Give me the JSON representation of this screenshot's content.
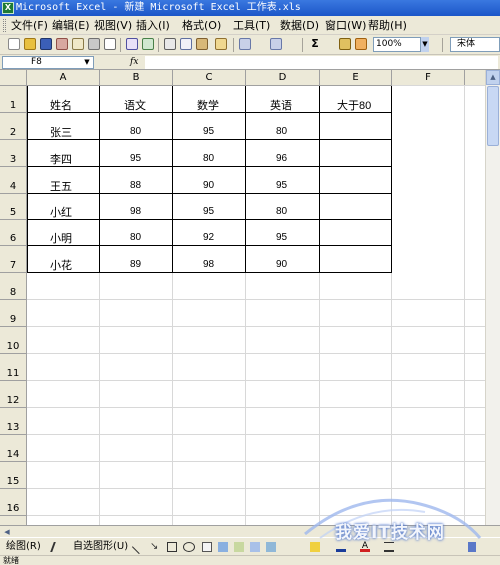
{
  "app": {
    "title": "Microsoft Excel - 新建 Microsoft Excel 工作表.xls",
    "icon_label": "X"
  },
  "menu": {
    "items": [
      "文件(F)",
      "编辑(E)",
      "视图(V)",
      "插入(I)",
      "格式(O)",
      "工具(T)",
      "数据(D)",
      "窗口(W)",
      "帮助(H)"
    ]
  },
  "toolbar": {
    "zoom": "100%",
    "font": "宋体",
    "icons": [
      "new-icon",
      "open-icon",
      "save-icon",
      "permission-icon",
      "email-icon",
      "print-icon",
      "print-preview-icon",
      "spelling-icon",
      "research-icon",
      "cut-icon",
      "copy-icon",
      "paste-icon",
      "format-painter-icon",
      "undo-icon",
      "redo-icon",
      "autosum-icon",
      "chart-wizard-icon",
      "drawing-icon"
    ]
  },
  "formula_bar": {
    "name_box": "F8",
    "fx": "fx",
    "formula": ""
  },
  "sheet": {
    "columns": [
      "A",
      "B",
      "C",
      "D",
      "E",
      "F"
    ],
    "rows": [
      "1",
      "2",
      "3",
      "4",
      "5",
      "6",
      "7",
      "8",
      "9",
      "10",
      "11",
      "12",
      "13",
      "14",
      "15",
      "16"
    ],
    "headers": [
      "姓名",
      "语文",
      "数学",
      "英语",
      "大于80"
    ],
    "data": [
      [
        "张三",
        "80",
        "95",
        "80",
        ""
      ],
      [
        "李四",
        "95",
        "80",
        "96",
        ""
      ],
      [
        "王五",
        "88",
        "90",
        "95",
        ""
      ],
      [
        "小红",
        "98",
        "95",
        "80",
        ""
      ],
      [
        "小明",
        "80",
        "92",
        "95",
        ""
      ],
      [
        "小花",
        "89",
        "98",
        "90",
        ""
      ]
    ]
  },
  "drawing_toolbar": {
    "draw_label": "绘图(R)",
    "autoshapes_label": "自选图形(U)"
  },
  "status": {
    "text": "就绪"
  },
  "watermark": {
    "text": "我爱IT技术网"
  },
  "colors": {
    "title_bar": "#1b56c8",
    "chrome": "#ece9d8",
    "grid_line": "#d8d8d8",
    "table_border": "#000000"
  }
}
